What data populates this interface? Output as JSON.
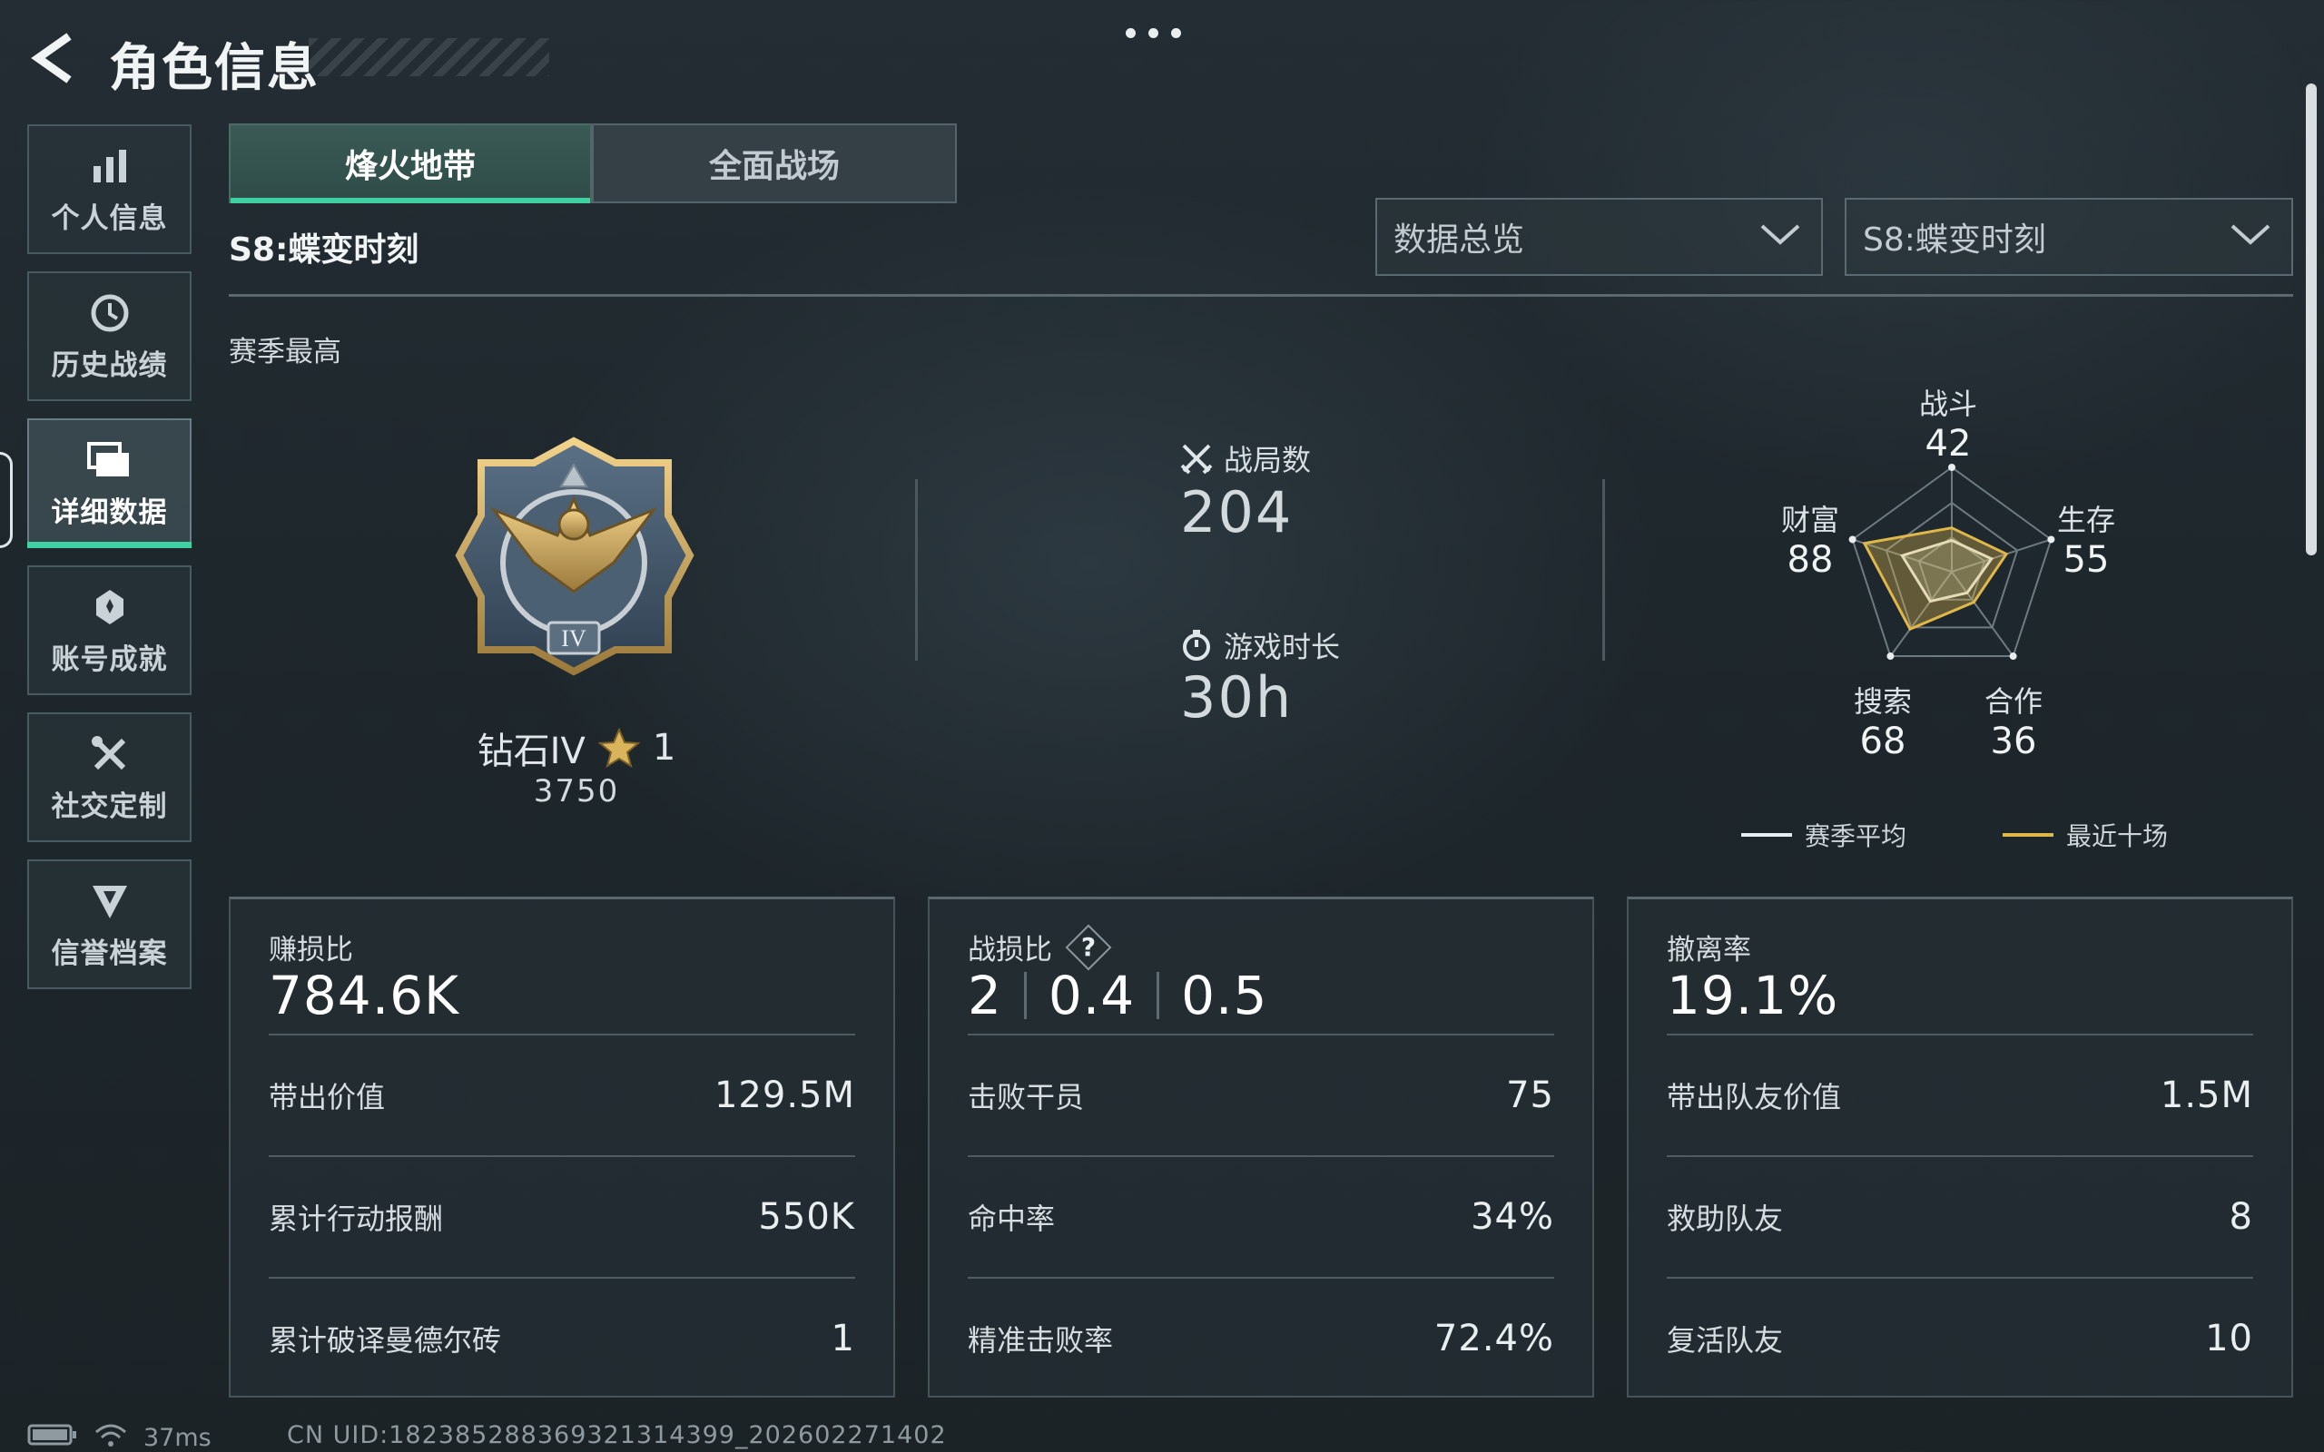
{
  "header": {
    "title": "角色信息"
  },
  "sidebar": {
    "items": [
      {
        "label": "个人信息",
        "icon": "bar-chart-icon",
        "active": false
      },
      {
        "label": "历史战绩",
        "icon": "history-clock-icon",
        "active": false
      },
      {
        "label": "详细数据",
        "icon": "folder-stack-icon",
        "active": true
      },
      {
        "label": "账号成就",
        "icon": "achievement-badge-icon",
        "active": false
      },
      {
        "label": "社交定制",
        "icon": "tools-crossed-icon",
        "active": false
      },
      {
        "label": "信誉档案",
        "icon": "shield-emblem-icon",
        "active": false
      }
    ]
  },
  "tabs": [
    {
      "label": "烽火地带",
      "active": true
    },
    {
      "label": "全面战场",
      "active": false
    }
  ],
  "season_title": "S8:蝶变时刻",
  "filters": {
    "view": "数据总览",
    "season": "S8:蝶变时刻"
  },
  "season_best": {
    "label": "赛季最高",
    "rank_name": "钻石IV",
    "stars": "1",
    "score": "3750"
  },
  "stats": {
    "matches_label": "战局数",
    "matches_value": "204",
    "playtime_label": "游戏时长",
    "playtime_value": "30h"
  },
  "radar": {
    "axes": [
      {
        "label": "战斗",
        "value": "42"
      },
      {
        "label": "生存",
        "value": "55"
      },
      {
        "label": "合作",
        "value": "36"
      },
      {
        "label": "搜索",
        "value": "68"
      },
      {
        "label": "财富",
        "value": "88"
      }
    ],
    "recent_values": [
      42,
      55,
      36,
      68,
      88
    ],
    "average_values": [
      30,
      40,
      25,
      35,
      50
    ],
    "legend": [
      {
        "label": "赛季平均",
        "color": "#e8eef0"
      },
      {
        "label": "最近十场",
        "color": "#e0b84a"
      }
    ]
  },
  "cards": [
    {
      "head_label": "赚损比",
      "head_value": "784.6K",
      "rows": [
        {
          "k": "带出价值",
          "v": "129.5M"
        },
        {
          "k": "累计行动报酬",
          "v": "550K"
        },
        {
          "k": "累计破译曼德尔砖",
          "v": "1"
        }
      ]
    },
    {
      "head_label": "战损比",
      "help": "?",
      "head_values": [
        "2",
        "0.4",
        "0.5"
      ],
      "rows": [
        {
          "k": "击败干员",
          "v": "75"
        },
        {
          "k": "命中率",
          "v": "34%"
        },
        {
          "k": "精准击败率",
          "v": "72.4%"
        }
      ]
    },
    {
      "head_label": "撤离率",
      "head_value": "19.1%",
      "rows": [
        {
          "k": "带出队友价值",
          "v": "1.5M"
        },
        {
          "k": "救助队友",
          "v": "8"
        },
        {
          "k": "复活队友",
          "v": "10"
        }
      ]
    }
  ],
  "footer": {
    "ping": "37ms",
    "uid": "CN UID:18238528836932131439​9_202602271402"
  },
  "colors": {
    "accent": "#3fd1a1",
    "gold": "#e0b84a"
  }
}
